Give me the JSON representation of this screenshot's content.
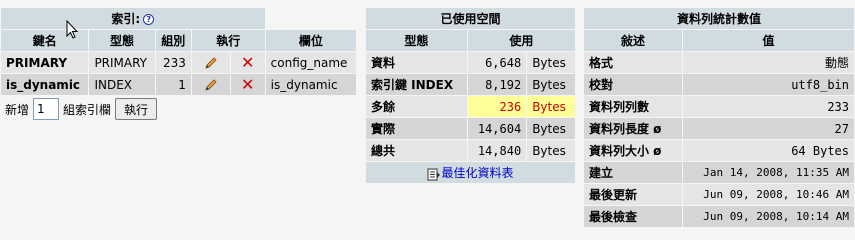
{
  "indexes": {
    "title": "索引:",
    "help_icon": "?",
    "headers": [
      "鍵名",
      "型態",
      "組別",
      "執行",
      "欄位"
    ],
    "rows": [
      {
        "key": "PRIMARY",
        "type": "PRIMARY",
        "cardinality": "233",
        "field": "config_name"
      },
      {
        "key": "is_dynamic",
        "type": "INDEX",
        "cardinality": "1",
        "field": "is_dynamic"
      }
    ],
    "add_label_prefix": "新增",
    "add_value": "1",
    "add_label_suffix": "組索引欄",
    "go_button": "執行"
  },
  "space": {
    "title": "已使用空間",
    "headers": [
      "型態",
      "使用"
    ],
    "rows": [
      {
        "label": "資料",
        "value": "6,648",
        "unit": "Bytes"
      },
      {
        "label": "索引鍵 INDEX",
        "value": "8,192",
        "unit": "Bytes"
      },
      {
        "label": "多餘",
        "value": "236",
        "unit": "Bytes"
      },
      {
        "label": "實際",
        "value": "14,604",
        "unit": "Bytes"
      },
      {
        "label": "總共",
        "value": "14,840",
        "unit": "Bytes"
      }
    ],
    "optimize_link": "最佳化資料表"
  },
  "stats": {
    "title": "資料列統計數值",
    "headers": [
      "敍述",
      "值"
    ],
    "rows": [
      {
        "label": "格式",
        "value": "動態"
      },
      {
        "label": "校對",
        "value": "utf8_bin"
      },
      {
        "label": "資料列列數",
        "value": "233"
      },
      {
        "label": "資料列長度 ø",
        "value": "27"
      },
      {
        "label": "資料列大小 ø",
        "value": "64 Bytes"
      },
      {
        "label": "建立",
        "value": "Jan 14, 2008, 11:35 AM"
      },
      {
        "label": "最後更新",
        "value": "Jun 09, 2008, 10:46 AM"
      },
      {
        "label": "最後檢查",
        "value": "Jun 09, 2008, 10:14 AM"
      }
    ]
  },
  "colors": {
    "header": "#d0dce0",
    "row_odd": "#e5e5e5",
    "row_even": "#d5d5d5",
    "highlight": "#ffff99",
    "highlight_text": "#cc0000",
    "link": "#0000cc"
  }
}
